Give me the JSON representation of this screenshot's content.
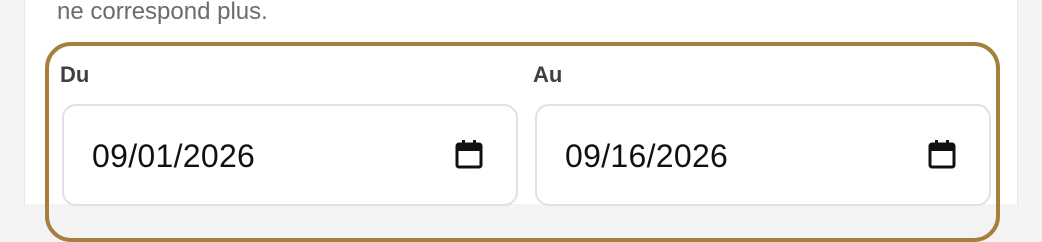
{
  "intro": {
    "text": "ne correspond plus."
  },
  "date_range": {
    "from": {
      "label": "Du",
      "value": "09/01/2026",
      "icon": "calendar-icon"
    },
    "to": {
      "label": "Au",
      "value": "09/16/2026",
      "icon": "calendar-icon"
    }
  },
  "colors": {
    "accent_border": "#a4803c",
    "input_border": "#e1e1e4",
    "label_text": "#3f3f44",
    "value_text": "#111114",
    "muted_text": "#6b6b70"
  }
}
